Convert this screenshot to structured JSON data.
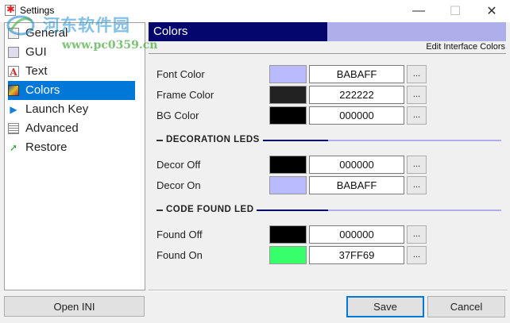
{
  "window": {
    "title": "Settings",
    "minimize_glyph": "—",
    "maximize_glyph": "☐",
    "close_glyph": "✕"
  },
  "watermark": {
    "cn_text": "河东软件园",
    "url_text": "www.pc0359.cn"
  },
  "nav": {
    "items": [
      {
        "label": "General",
        "icon": "general-icon"
      },
      {
        "label": "GUI",
        "icon": "gui-icon"
      },
      {
        "label": "Text",
        "icon": "text-icon",
        "glyph": "A"
      },
      {
        "label": "Colors",
        "icon": "colors-icon",
        "selected": true
      },
      {
        "label": "Launch Key",
        "icon": "launch-key-icon",
        "glyph": "▶"
      },
      {
        "label": "Advanced",
        "icon": "advanced-icon"
      },
      {
        "label": "Restore",
        "icon": "restore-icon",
        "glyph": "➚"
      }
    ],
    "open_ini_label": "Open INI"
  },
  "panel": {
    "title": "Colors",
    "subtitle": "Edit Interface Colors",
    "ellipsis": "...",
    "sections": [
      {
        "heading": "",
        "rows": [
          {
            "label": "Font Color",
            "hex": "BABAFF",
            "swatch": "#BABAFF"
          },
          {
            "label": "Frame Color",
            "hex": "222222",
            "swatch": "#222222"
          },
          {
            "label": "BG Color",
            "hex": "000000",
            "swatch": "#000000"
          }
        ]
      },
      {
        "heading": "DECORATION LEDS",
        "rows": [
          {
            "label": "Decor Off",
            "hex": "000000",
            "swatch": "#000000"
          },
          {
            "label": "Decor On",
            "hex": "BABAFF",
            "swatch": "#BABAFF"
          }
        ]
      },
      {
        "heading": "CODE FOUND LED",
        "rows": [
          {
            "label": "Found Off",
            "hex": "000000",
            "swatch": "#000000"
          },
          {
            "label": "Found On",
            "hex": "37FF69",
            "swatch": "#37FF69"
          }
        ]
      }
    ]
  },
  "footer": {
    "save_label": "Save",
    "cancel_label": "Cancel"
  },
  "colors": {
    "header_dark": "#05056E",
    "header_light": "#AEAEEA",
    "selection": "#0078D7"
  }
}
